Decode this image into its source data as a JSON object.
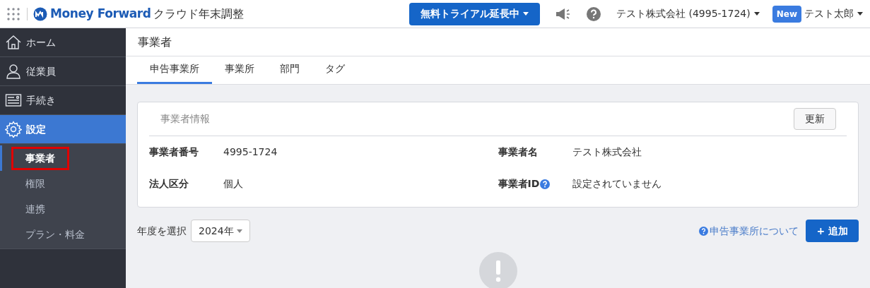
{
  "header": {
    "brand": "Money Forward",
    "product": "クラウド年末調整",
    "trial_button": "無料トライアル延長中",
    "company_menu": "テスト株式会社 (4995-1724)",
    "new_badge": "New",
    "user_menu": "テスト太郎"
  },
  "sidebar": {
    "items": [
      {
        "label": "ホーム",
        "kind": "home",
        "selected": false
      },
      {
        "label": "従業員",
        "kind": "user",
        "selected": false
      },
      {
        "label": "手続き",
        "kind": "form",
        "selected": false
      },
      {
        "label": "設定",
        "kind": "gear",
        "selected": true,
        "children": [
          {
            "label": "事業者",
            "selected": true,
            "highlighted": true
          },
          {
            "label": "権限",
            "selected": false,
            "highlighted": false
          },
          {
            "label": "連携",
            "selected": false,
            "highlighted": false
          },
          {
            "label": "プラン・料金",
            "selected": false,
            "highlighted": false
          }
        ]
      }
    ]
  },
  "page": {
    "title": "事業者",
    "tabs": [
      {
        "label": "申告事業所",
        "selected": true
      },
      {
        "label": "事業所",
        "selected": false
      },
      {
        "label": "部門",
        "selected": false
      },
      {
        "label": "タグ",
        "selected": false
      }
    ],
    "card": {
      "title": "事業者情報",
      "update_button": "更新",
      "fields": [
        {
          "label": "事業者番号",
          "value": "4995-1724",
          "help": false
        },
        {
          "label": "事業者名",
          "value": "テスト株式会社",
          "help": false
        },
        {
          "label": "法人区分",
          "value": "個人",
          "help": false
        },
        {
          "label": "事業者ID",
          "value": "設定されていません",
          "help": true
        }
      ]
    },
    "year_label": "年度を選択",
    "year_select": "2024年",
    "help_link": "申告事業所について",
    "add_button": "+ 追加"
  }
}
